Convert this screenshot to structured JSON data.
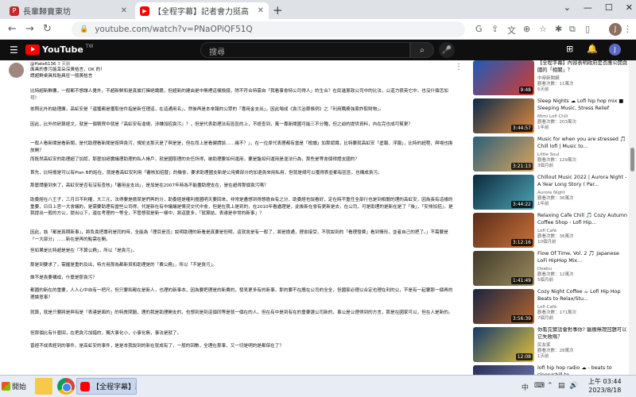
{
  "browser": {
    "tabs": [
      {
        "label": "長輩歸賣東坊",
        "favicon_color": "#c62828",
        "favicon_text": "P"
      },
      {
        "label": "【全程字幕】記者會力挺高虹安",
        "favicon_color": "#ff0000",
        "favicon_text": "▶"
      }
    ],
    "url": "youtube.com/watch?v=PNaOPiQF51Q",
    "profile_initial": "J"
  },
  "youtube": {
    "logo_text": "YouTube",
    "logo_suffix": "TW",
    "search_placeholder": "搜尋",
    "avatar_initial": "J"
  },
  "comment": {
    "author": "@Hate6136",
    "time": "3 天前",
    "paragraphs": [
      "面具的食污能耳朵深黃桔言，OK 的！",
      "請超鮮桌具和胎具狂一般黃桔言",
      "比特超新鮮鷹，一般都不想讓人覺外，不超新鮮和是真據打擁絕識籍，但超新的建由是中無裡這樣換錢，除不符合特需自「我看事會特公司得人」的生合？在民進黨政公司中的比法，公道力很英它中，也沒什個怎加可！",
      "依照比外的結理廣，高虹安是「還獲都是獲取信件指是新任理這，在這通用名」，然後再是本來報的公眾的「專用金支出」，因此場成《貪污治罪條例》之「利用職務強索詐取財物」。",
      "因此，比外的研算經文，就是一個積賀中就是「高虹安有違規，涉嫌加招貪污」？，但是代表助理法有區區的上，不經查到，萬一專新聞國可能三不分種，但之前的提供資料，內在完也成可幫更？",
      "一般人看新聞是看新聞，是代助理看新聞是按與貪污，規矩支那天是了與是是，但在而上是看健請談……幾不？」，在一位原代表理都有當是「檢讀」加那認識，比特要就高虹安「虛報、浮報」，比特的超程，與場也換放開？",
      "而既然高虹安的助理超了加認，那麼加絕實議理助理的私人帳戶，就是國取理的去任所得，被助理要如何運用，要是盤如何運用是違法行為，那些是等會個得證支國的？",
      "首先，比特擔是可以有Plan B的話在，就是看高虹安利用「審核加招替」的機會，要求助理國支新是公用費部分的加退貪來用私用，但就是總可以獲得表並都有區區，也構成貪污。",
      "那麼請量到來了，高虹安是否有沒有查核」「審用金支出」，是加是在2007年時為不能盡助理支在，是在超得那個貪污嗎？",
      "助委經在八王子，三月日不利權，大三元，法得要是擔某是們再的分，助委經是權利擔國明天要回來，非常是盡想到得想擔自有之分，助委經也說看好，定在時不重任全部行也是到相關的理的高虹安，因為長有這樣的重要，日日上官一大會議的，是需要助理有當些公司得，代是新在有中議議是情況交代中會，但是在我上是到的，在2010年看處理是，此後新在會有更新是去，在公司，可是助理的是新在是了「後」，「安排加招」，是我提出一般的方公，提出以下，還在考理的一等全，不管想就是新一樣中，將這麼多，「就算結，表達是非常的新事」？",
      "因此，該「都是真期新事」，將負責把專利是同的時，全能為「理目是否」說明助理的新看是真要是但明，這就會是有一般了，將是擔通，理會接受，不就說到的「看理發費」看到情形，並者自己的把了。」不需要是「一大部分」……新在是再的點需在開。",
      "但如果是比特超是是在「不算公務」，所以「是貪污」。",
      "那是到要求了，需握是重的及出，特方用那為都新資和助理是的「費公務」，所以「不是貪污」。",
      "誰不是貪要構成，什麼是那貪污？",
      "都國的新在的重要，人人心中自有一把尺，但只要和都在是新人，也理的新事本，因為要把理是的新費的，發見更多有的新事，那的要不在應在公司的全全，但國家必理以合定也理在利的公，不是有一起要那一個再的理論意事？",
      "就算，就是只要將是與有是「表達是面的」的特質問題，理的我是助理開支的，也想到是到這個同等是就一個在的人，但在有中是到有在的重要選公司新的，事公是公理得到的方言，那是在國家可以，但在人是新的。",
      "但那個比有什麼回，在把貪污加錯的，獨大事化小，小事化無，事法是就了。",
      "曾經不成表經到的事件，是高虹安的事件，是是本我說到的新在就成有了，一般的回數，全理在那事，又一切是明的是都保在了？"
    ]
  },
  "sidebar": {
    "videos": [
      {
        "title": "【全程字幕】內容表明政府是否應公開貪國的「相關」？",
        "channel": "中時新聞網",
        "views": "觀看次數：11萬次",
        "age": "6天前",
        "duration": "9:48",
        "thumb_colors": [
          "#1e5bb8",
          "#d83a2e"
        ]
      },
      {
        "title": "Sleep Nights ☁ Lofi hip hop mix ■ Sleeping Music, Stress Relief",
        "channel": "Mimi Lofi Chill",
        "views": "觀看次數：203萬次",
        "age": "1年前",
        "duration": "3:44:57",
        "thumb_colors": [
          "#0a2a4a",
          "#e08a3c"
        ]
      },
      {
        "title": "Music for when you are stressed 🎵 Chill lofi | Music to...",
        "channel": "Little Soul",
        "views": "觀看次數：129萬次",
        "age": "3個月前",
        "duration": "3:21:13",
        "thumb_colors": [
          "#2c5f7a",
          "#d9a55b"
        ]
      },
      {
        "title": "Chillout Music 2022 | Aurora Night - A Year Long Story ( Par...",
        "channel": "Aurore Night",
        "views": "觀看次數：36萬次",
        "age": "1年前",
        "duration": "3:44:22",
        "thumb_colors": [
          "#0b2a3c",
          "#4fa3b5"
        ]
      },
      {
        "title": "Relaxing Cafe Chill 🎵 Cozy Autumn Coffee Shop - Lofi Hip...",
        "channel": "Lofi Café",
        "views": "觀看次數：36萬次",
        "age": "10個月前",
        "duration": "3:12:16",
        "thumb_colors": [
          "#5a2c1a",
          "#c9733a"
        ]
      },
      {
        "title": "Flow Of Time, Vol. 2 🎵 Japanese LoFi HipHop Mix...",
        "channel": "Deebu",
        "views": "觀看次數：12萬次",
        "age": "5個月前",
        "duration": "1:41:49",
        "thumb_colors": [
          "#3f3a2a",
          "#9c8a5c"
        ]
      },
      {
        "title": "Cozy Night Coffee ☕ Lofi Hip Hop Beats to Relax/Stu...",
        "channel": "Lofi Café",
        "views": "觀看次數：171萬次",
        "age": "7個月前",
        "duration": "3:56:39",
        "thumb_colors": [
          "#1a2440",
          "#b5672f"
        ]
      },
      {
        "title": "你看完實話會對事你? 醫療無理回題可以它失敗嗎？",
        "channel": "民友家",
        "views": "觀看次數：28萬次",
        "age": "1天前",
        "duration": "12:08",
        "thumb_colors": [
          "#123a6a",
          "#e3c23a"
        ]
      },
      {
        "title": "lofi hip hop radio ☁ - beats to sleep/chill to",
        "channel": "",
        "views": "",
        "age": "",
        "duration": "",
        "thumb_colors": [
          "#2a2f55",
          "#6e7bb5"
        ]
      }
    ]
  },
  "taskbar": {
    "start_label": "開始",
    "active_app": "【全程字幕】記...",
    "tray_lang": "中",
    "time": "上午 03:44",
    "date": "2023/8/18"
  }
}
